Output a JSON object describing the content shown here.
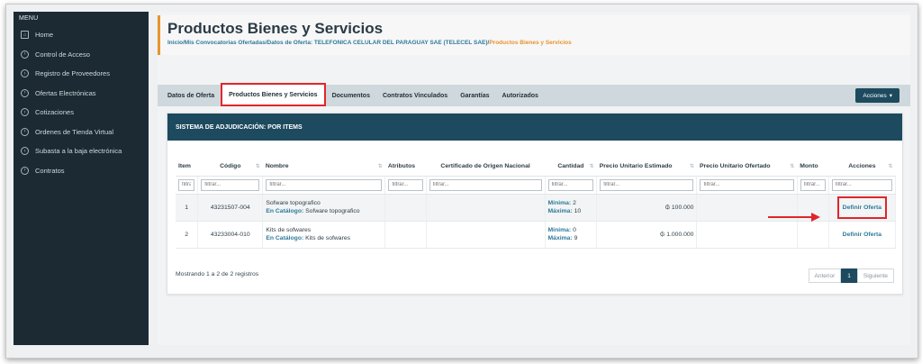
{
  "sidebar": {
    "menu_title": "MENU",
    "items": [
      {
        "label": "Home",
        "icon": "home-icon"
      },
      {
        "label": "Control de Acceso",
        "icon": "chevron-right-icon"
      },
      {
        "label": "Registro de Proveedores",
        "icon": "chevron-right-icon"
      },
      {
        "label": "Ofertas Electrónicas",
        "icon": "chevron-right-icon"
      },
      {
        "label": "Cotizaciones",
        "icon": "chevron-right-icon"
      },
      {
        "label": "Ordenes de Tienda Virtual",
        "icon": "chevron-right-icon"
      },
      {
        "label": "Subasta a la baja electrónica",
        "icon": "chevron-right-icon"
      },
      {
        "label": "Contratos",
        "icon": "chevron-right-icon"
      }
    ]
  },
  "header": {
    "title": "Productos Bienes y Servicios",
    "breadcrumb_path": "Inicio/Mis Convocatorias Ofertadas/Datos de Oferta: TELEFONICA CELULAR DEL PARAGUAY SAE (TELECEL SAE)/",
    "breadcrumb_current": "Productos Bienes y Servicios"
  },
  "tabs": [
    {
      "label": "Datos de Oferta",
      "active": false
    },
    {
      "label": "Productos Bienes y Servicios",
      "active": true
    },
    {
      "label": "Documentos",
      "active": false
    },
    {
      "label": "Contratos Vinculados",
      "active": false
    },
    {
      "label": "Garantías",
      "active": false
    },
    {
      "label": "Autorizados",
      "active": false
    }
  ],
  "acciones_button": "Acciones",
  "panel": {
    "title": "SISTEMA DE ADJUDICACIÓN: POR ITEMS",
    "columns": [
      "Item",
      "Código",
      "Nombre",
      "Atributos",
      "Certificado de Origen Nacional",
      "Cantidad",
      "Precio Unitario Estimado",
      "Precio Unitario Ofertado",
      "Monto",
      "Acciones"
    ],
    "filter_placeholders": [
      "filtra",
      "filtrar...",
      "filtrar...",
      "filtrar...",
      "filtrar...",
      "filtrar...",
      "filtrar...",
      "filtrar...",
      "filtrar...",
      "filtrar..."
    ],
    "catalog_label": "En Catálogo:",
    "min_label": "Mínima:",
    "max_label": "Máxima:",
    "rows": [
      {
        "item": "1",
        "codigo": "43231507-004",
        "nombre": "Sofware topografico",
        "catalogo": "Sofware topografico",
        "minima": "2",
        "maxima": "10",
        "precio_estimado": "₲ 100.000",
        "accion": "Definir Oferta"
      },
      {
        "item": "2",
        "codigo": "43233004-010",
        "nombre": "Kits de sofwares",
        "catalogo": "Kits de sofwares",
        "minima": "0",
        "maxima": "9",
        "precio_estimado": "₲ 1.000.000",
        "accion": "Definir Oferta"
      }
    ],
    "footer_info": "Mostrando 1 a 2 de 2 registros",
    "pager": {
      "prev": "Anterior",
      "current": "1",
      "next": "Siguiente"
    }
  },
  "colors": {
    "accent": "#e8932e",
    "panel_header": "#1d4a5e",
    "highlight": "#e0262b",
    "sidebar": "#1b2a33"
  }
}
